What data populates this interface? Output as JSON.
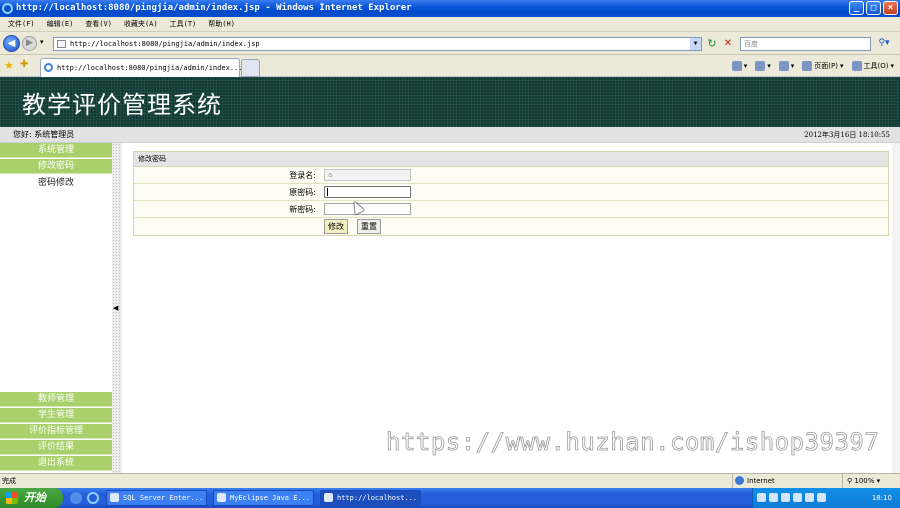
{
  "window": {
    "title": "http://localhost:8080/pingjia/admin/index.jsp - Windows Internet Explorer",
    "controls": [
      "_",
      "□",
      "×"
    ]
  },
  "menubar": [
    "文件(F)",
    "编辑(E)",
    "查看(V)",
    "收藏夹(A)",
    "工具(T)",
    "帮助(H)"
  ],
  "address": {
    "url": "http://localhost:8080/pingjia/admin/index.jsp",
    "search_placeholder": "百度"
  },
  "tab": {
    "label": "http://localhost:8080/pingjia/admin/index..."
  },
  "commandbar": {
    "page": "页面(P)",
    "tools": "工具(O)"
  },
  "page": {
    "title": "教学评价管理系统",
    "greeting": "您好: 系统管理员",
    "datetime": "2012年3月16日  18:10:55"
  },
  "sidebar": {
    "top_items": [
      "系统管理",
      "修改密码"
    ],
    "sub_item": "密码修改",
    "bottom_items": [
      "教师管理",
      "学生管理",
      "评价指标管理",
      "评价结果",
      "退出系统"
    ]
  },
  "form": {
    "heading": "修改密码",
    "fields": [
      {
        "label": "登录名:",
        "value": "a"
      },
      {
        "label": "原密码:",
        "value": ""
      },
      {
        "label": "新密码:",
        "value": ""
      }
    ],
    "submit_label": "修改",
    "reset_label": "重置"
  },
  "watermark": "https://www.huzhan.com/ishop39397",
  "statusbar": {
    "status": "完成",
    "zone": "Internet",
    "zoom": "100%"
  },
  "taskbar": {
    "start": "开始",
    "tasks": [
      "SQL Server Enter...",
      "MyEclipse Java E...",
      "http://localhost..."
    ],
    "clock": "18:10"
  },
  "colors": {
    "banner": "#0f3b34",
    "sidebar_button": "#a9d06a",
    "titlebar": "#0a58d8",
    "taskbar": "#245edb"
  }
}
